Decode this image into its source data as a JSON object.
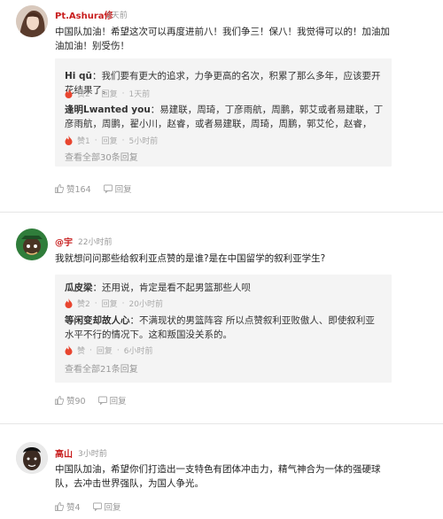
{
  "comments": [
    {
      "username": "Pt.Ashura修",
      "time": "2天前",
      "text": "中国队加油！希望这次可以再度进前八！我们争三！保八！我觉得可以的！加油加油加油！别受伤！",
      "replies": [
        {
          "name": "Hi qū",
          "text": "我们要有更大的追求，力争更高的名次，积累了那么多年，应该要开花结果了。",
          "likes": "赞2",
          "reply_label": "回复",
          "time": "1天前"
        },
        {
          "name": "逢明Lwanted you",
          "text": "易建联，周琦，丁彦雨航，周鹏，郭艾或者易建联，丁彦雨航，周鹏，翟小川，赵睿，或者易建联，周琦，周鹏，郭艾伦，赵睿，",
          "likes": "赞1",
          "reply_label": "回复",
          "time": "5小时前"
        }
      ],
      "view_all": "查看全部30条回复",
      "like_count": "赞164",
      "reply_action": "回复"
    },
    {
      "username": "@宇",
      "time": "22小时前",
      "text": "我就想问问那些给叙利亚点赞的是谁?是在中国留学的叙利亚学生?",
      "replies": [
        {
          "name": "瓜皮梁",
          "text": "还用说，肯定是看不起男篮那些人呗",
          "likes": "赞2",
          "reply_label": "回复",
          "time": "20小时前"
        },
        {
          "name": "等闲变却故人心",
          "text": "不满现状的男篮阵容 所以点赞叙利亚败傲人、即使叙利亚水平不行的情况下。这和叛国没关系的。",
          "likes": "赞",
          "reply_label": "回复",
          "time": "6小时前"
        }
      ],
      "view_all": "查看全部21条回复",
      "like_count": "赞90",
      "reply_action": "回复"
    },
    {
      "username": "高山",
      "time": "3小时前",
      "text": "中国队加油，希望你们打造出一支特色有团体冲击力，精气神合为一体的强硬球队，去冲击世界强队，为国人争光。",
      "like_count": "赞4",
      "reply_action": "回复"
    }
  ],
  "colors": {
    "username": "#c81e1e",
    "flame": "#e8452f",
    "meta": "#999999",
    "reply_bg": "#f4f4f4"
  },
  "icons": [
    "flame-icon",
    "thumb-up-icon",
    "reply-icon"
  ]
}
